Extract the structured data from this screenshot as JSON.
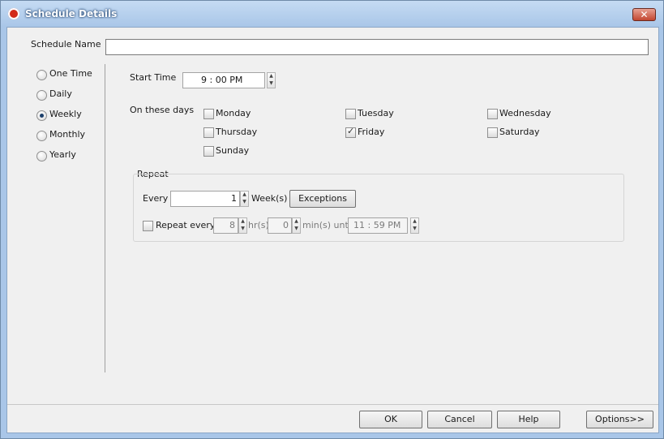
{
  "window": {
    "title": "Schedule Details",
    "close_glyph": "✕"
  },
  "schedule_name": {
    "label": "Schedule Name",
    "value": ""
  },
  "frequency": {
    "options": [
      "One Time",
      "Daily",
      "Weekly",
      "Monthly",
      "Yearly"
    ],
    "selected": "Weekly"
  },
  "start_time": {
    "label": "Start Time",
    "value": "9 : 00 PM"
  },
  "days": {
    "label": "On these days",
    "items": [
      {
        "name": "Monday",
        "checked": false
      },
      {
        "name": "Tuesday",
        "checked": false
      },
      {
        "name": "Wednesday",
        "checked": false
      },
      {
        "name": "Thursday",
        "checked": false
      },
      {
        "name": "Friday",
        "checked": true
      },
      {
        "name": "Saturday",
        "checked": false
      },
      {
        "name": "Sunday",
        "checked": false
      }
    ]
  },
  "repeat": {
    "title": "Repeat",
    "every_label": "Every",
    "every_value": "1",
    "unit": "Week(s)",
    "exceptions_label": "Exceptions",
    "repeat_every_label": "Repeat every",
    "hours_value": "8",
    "hours_unit": "hr(s)",
    "minutes_value": "0",
    "minutes_unit": "min(s) until",
    "until_value": "11 : 59 PM"
  },
  "buttons": {
    "ok": "OK",
    "cancel": "Cancel",
    "help": "Help",
    "options": "Options>>"
  },
  "colors": {
    "title_bar": "#a9c6e8",
    "client_bg": "#f0f0f0",
    "close_button": "#c24630"
  }
}
